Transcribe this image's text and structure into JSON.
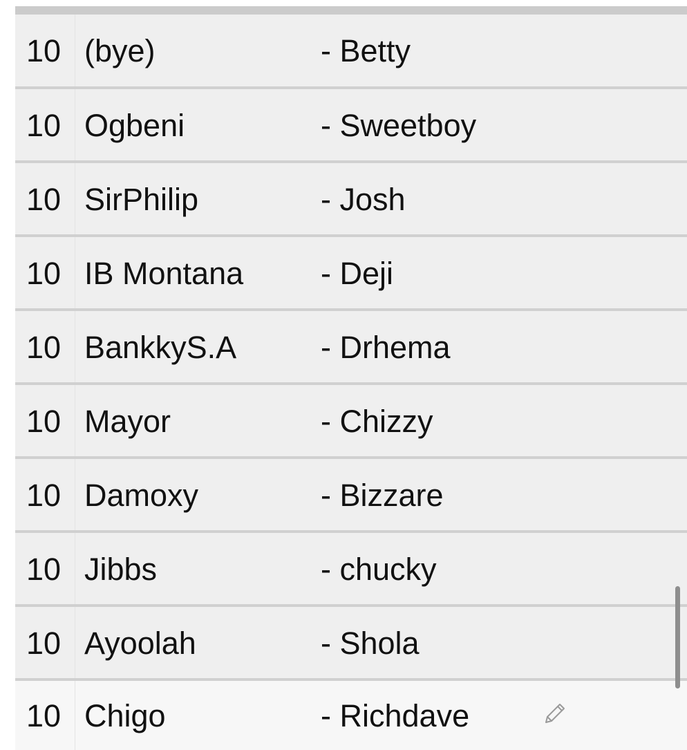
{
  "rows": [
    {
      "score": "10",
      "name": "(bye)",
      "partner": "- Betty"
    },
    {
      "score": "10",
      "name": "Ogbeni",
      "partner": "- Sweetboy"
    },
    {
      "score": "10",
      "name": "SirPhilip",
      "partner": "- Josh"
    },
    {
      "score": "10",
      "name": "IB Montana",
      "partner": "- Deji"
    },
    {
      "score": "10",
      "name": "BankkyS.A",
      "partner": "- Drhema"
    },
    {
      "score": "10",
      "name": "Mayor",
      "partner": "- Chizzy"
    },
    {
      "score": "10",
      "name": "Damoxy",
      "partner": "- Bizzare"
    },
    {
      "score": "10",
      "name": "Jibbs",
      "partner": "- chucky"
    },
    {
      "score": "10",
      "name": "Ayoolah",
      "partner": "- Shola"
    },
    {
      "score": "10",
      "name": "Chigo",
      "partner": "- Richdave"
    }
  ],
  "icons": {
    "edit": "pencil-icon"
  },
  "colors": {
    "row_background": "#efefef",
    "last_row_background": "#f7f7f7",
    "divider": "#d0d0d0",
    "text": "#111111"
  }
}
